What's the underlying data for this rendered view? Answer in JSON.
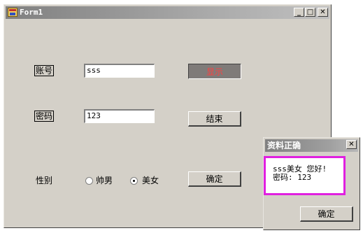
{
  "window": {
    "title": "Form1",
    "controls": {
      "minimize": "_",
      "maximize": "□",
      "close": "✕"
    }
  },
  "form": {
    "account_label": "账号",
    "account_value": "sss",
    "password_label": "密码",
    "password_value": "123",
    "gender_label": "性别",
    "gender_options": [
      {
        "label": "帅男",
        "checked": false
      },
      {
        "label": "美女",
        "checked": true
      }
    ],
    "show_button": "显示",
    "end_button": "结束",
    "confirm_button": "确定"
  },
  "dialog": {
    "title": "资料正确",
    "close": "✕",
    "message_line1": "sss美女 您好!",
    "message_line2": "密码: 123",
    "ok_button": "确定"
  },
  "colors": {
    "face": "#d4d0c8",
    "pressed_text": "#ff4040",
    "highlight": "#e020e0"
  }
}
